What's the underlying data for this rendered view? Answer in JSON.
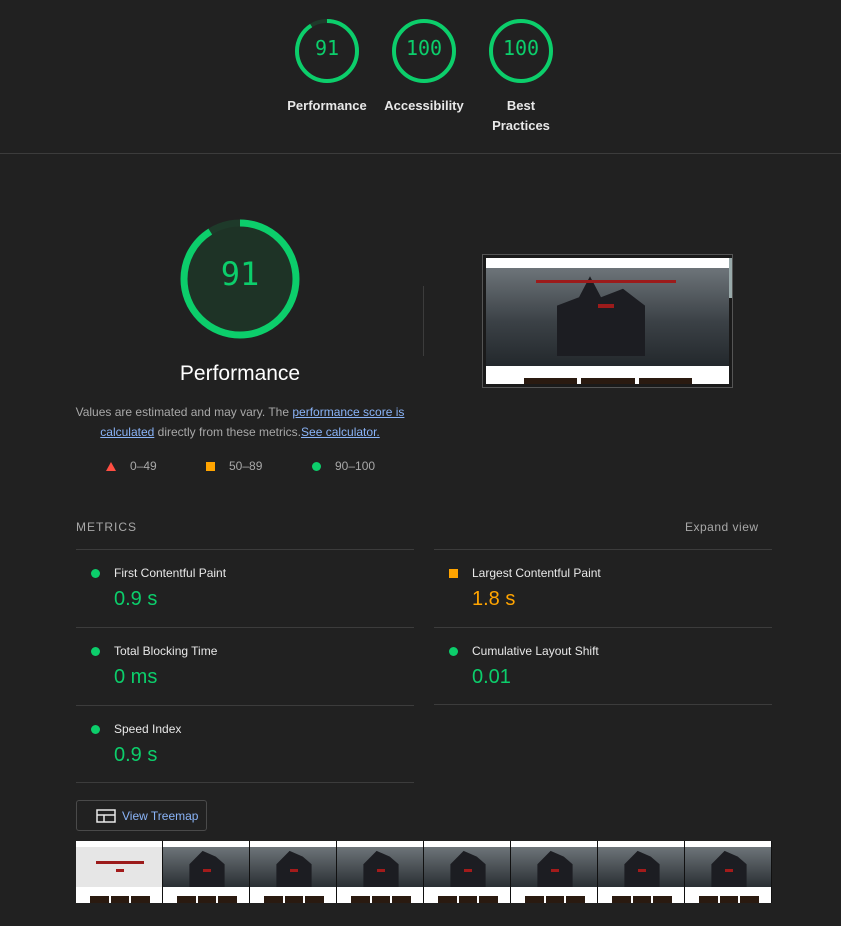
{
  "top_scores": [
    {
      "score": "91",
      "label": "Performance",
      "fraction": 0.91
    },
    {
      "score": "100",
      "label": "Accessibility",
      "fraction": 1.0
    },
    {
      "score": "100",
      "label_line1": "Best",
      "label_line2": "Practices",
      "fraction": 1.0
    }
  ],
  "performance": {
    "score": "91",
    "fraction": 0.91,
    "title": "Performance",
    "desc_prefix": "Values are estimated and may vary. The ",
    "desc_link1": "performance score is calculated",
    "desc_middle": " directly from these metrics.",
    "desc_link2": "See calculator."
  },
  "legend": [
    {
      "range": "0–49",
      "shape": "triangle",
      "color": "#ff4e42"
    },
    {
      "range": "50–89",
      "shape": "square",
      "color": "#ffa400"
    },
    {
      "range": "90–100",
      "shape": "circle",
      "color": "#0cce6b"
    }
  ],
  "metrics": {
    "heading": "METRICS",
    "expand": "Expand view",
    "items": [
      {
        "label": "First Contentful Paint",
        "value": "0.9 s",
        "status": "pass"
      },
      {
        "label": "Largest Contentful Paint",
        "value": "1.8 s",
        "status": "average"
      },
      {
        "label": "Total Blocking Time",
        "value": "0 ms",
        "status": "pass"
      },
      {
        "label": "Cumulative Layout Shift",
        "value": "0.01",
        "status": "pass"
      },
      {
        "label": "Speed Index",
        "value": "0.9 s",
        "status": "pass"
      }
    ]
  },
  "treemap_button": "View Treemap",
  "colors": {
    "pass": "#0cce6b",
    "average": "#ffa400",
    "fail": "#ff4e42",
    "link": "#8ab4f8"
  }
}
